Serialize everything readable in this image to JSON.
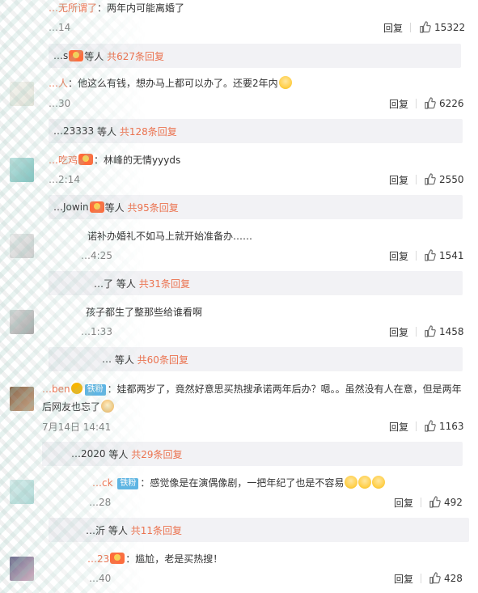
{
  "comments": [
    {
      "username": "…无所谓了",
      "text": "：两年内可能离婚了",
      "time": "…14",
      "reply_label": "回复",
      "likes": "15322",
      "sub": {
        "prefix": "…s",
        "suffix": "等人",
        "more": "共627条回复"
      }
    },
    {
      "username": "…人",
      "text": "：他这么有钱，想办马上都可以办了。还要2年内",
      "time": "…30",
      "reply_label": "回复",
      "likes": "6226",
      "sub": {
        "prefix": "…23333",
        "suffix": "等人",
        "more": "共128条回复"
      }
    },
    {
      "username": "…吃鸡",
      "text": "：林峰的无情yyyds",
      "time": "…2:14",
      "reply_label": "回复",
      "likes": "2550",
      "sub": {
        "prefix": "…Jowin",
        "suffix": "等人",
        "more": "共95条回复"
      }
    },
    {
      "username": "",
      "text": "诺补办婚礼不如马上就开始准备办……",
      "time": "…4:25",
      "reply_label": "回复",
      "likes": "1541",
      "sub": {
        "prefix": "…了",
        "suffix": "等人",
        "more": "共31条回复"
      }
    },
    {
      "username": "",
      "text": "孩子都生了整那些给谁看啊",
      "time": "…1:33",
      "reply_label": "回复",
      "likes": "1458",
      "sub": {
        "prefix": "…",
        "suffix": "等人",
        "more": "共60条回复"
      }
    },
    {
      "username": "…ben",
      "badge": "铁粉",
      "text": "：娃都两岁了，竟然好意思买热搜承诺两年后办？嗯。。虽然没有人在意，但是两年后网友也忘了",
      "time": "7月14日 14:41",
      "reply_label": "回复",
      "likes": "1163",
      "sub": {
        "prefix": "…2020",
        "suffix": "等人",
        "more": "共29条回复"
      }
    },
    {
      "username": "…ck",
      "badge": "铁粉",
      "text": "：感觉像是在演偶像剧，一把年纪了也是不容易",
      "time": "…28",
      "reply_label": "回复",
      "likes": "492",
      "sub": {
        "prefix": "…沂",
        "suffix": "等人",
        "more": "共11条回复"
      }
    },
    {
      "username": "…23",
      "text": "：尴尬，老是买热搜！",
      "time": "…40",
      "reply_label": "回复",
      "likes": "428"
    }
  ]
}
